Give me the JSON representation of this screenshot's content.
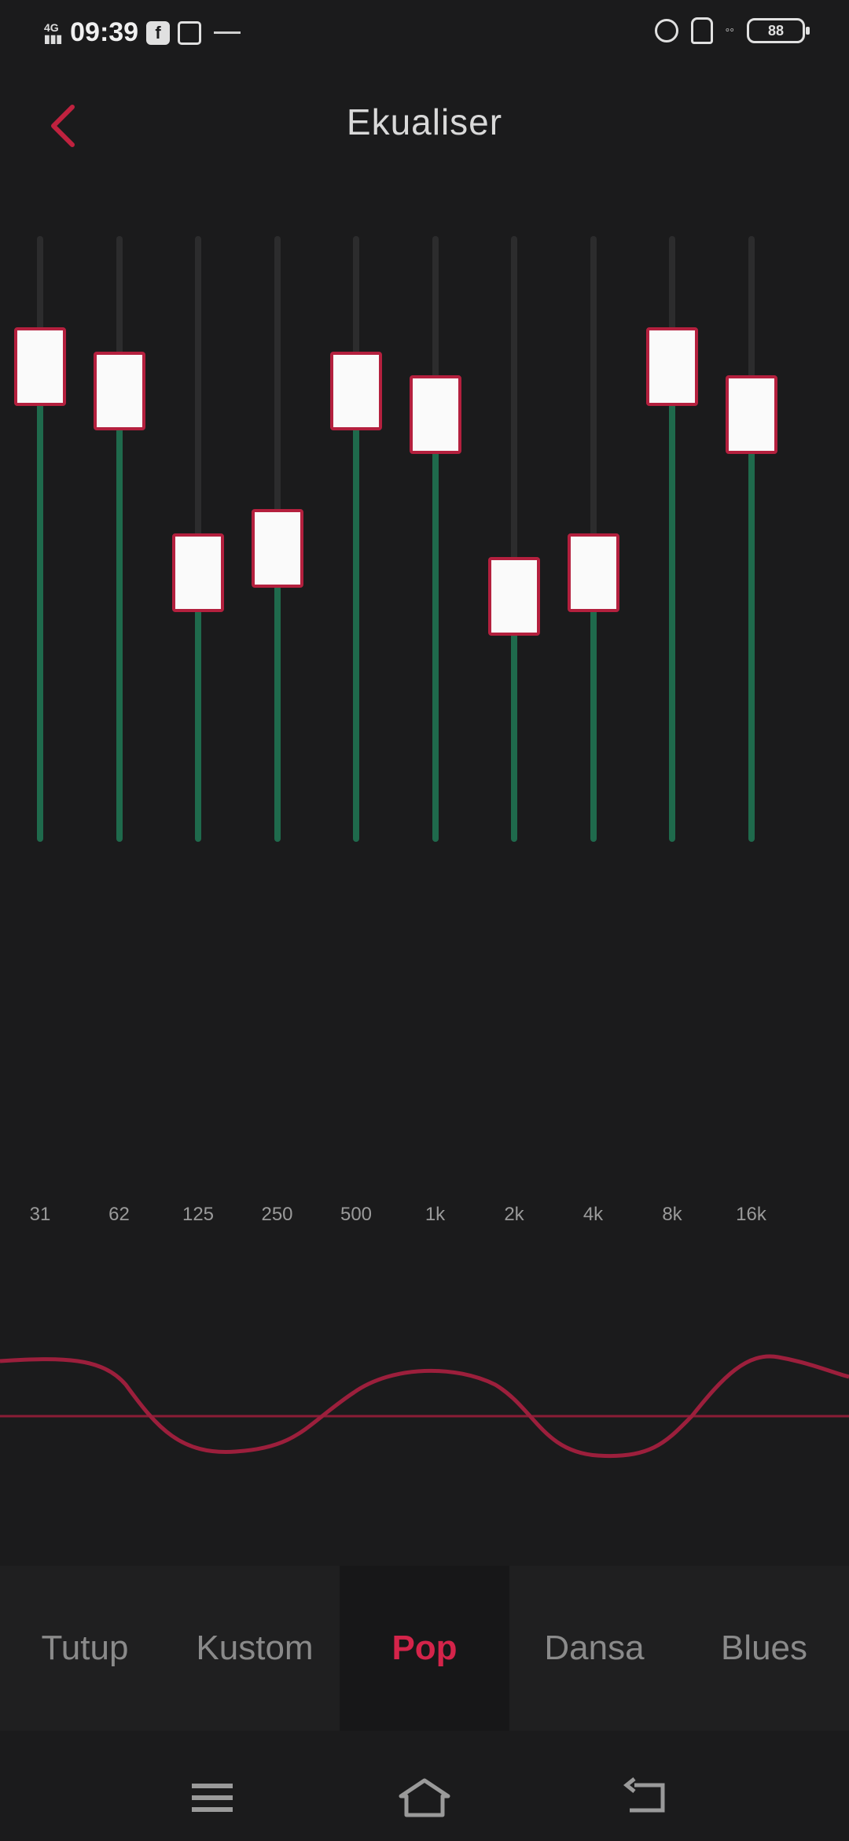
{
  "status_bar": {
    "time": "09:39",
    "left_icons": [
      "signal-icon",
      "facebook-icon",
      "gallery-icon",
      "dash-icon"
    ],
    "right_icons": [
      "alarm-icon",
      "silent-icon",
      "wifi-icon",
      "battery-icon"
    ],
    "battery_level": "88"
  },
  "header": {
    "title": "Ekualiser",
    "back_icon": "chevron-left-icon"
  },
  "equalizer": {
    "accent_color": "#1f6a4c",
    "thumb_border_color": "#b4203e",
    "bands": [
      {
        "label": "31",
        "level": 0.79
      },
      {
        "label": "62",
        "level": 0.75
      },
      {
        "label": "125",
        "level": 0.45
      },
      {
        "label": "250",
        "level": 0.49
      },
      {
        "label": "500",
        "level": 0.75
      },
      {
        "label": "1k",
        "level": 0.71
      },
      {
        "label": "2k",
        "level": 0.41
      },
      {
        "label": "4k",
        "level": 0.45
      },
      {
        "label": "8k",
        "level": 0.79
      },
      {
        "label": "16k",
        "level": 0.71
      }
    ]
  },
  "curve": {
    "color": "#9c1f3c"
  },
  "presets": {
    "items": [
      "Tutup",
      "Kustom",
      "Pop",
      "Dansa",
      "Blues"
    ],
    "active": "Pop",
    "active_color": "#d4244a"
  },
  "nav_bar": {
    "icons": [
      "menu-icon",
      "home-icon",
      "back-icon"
    ]
  }
}
